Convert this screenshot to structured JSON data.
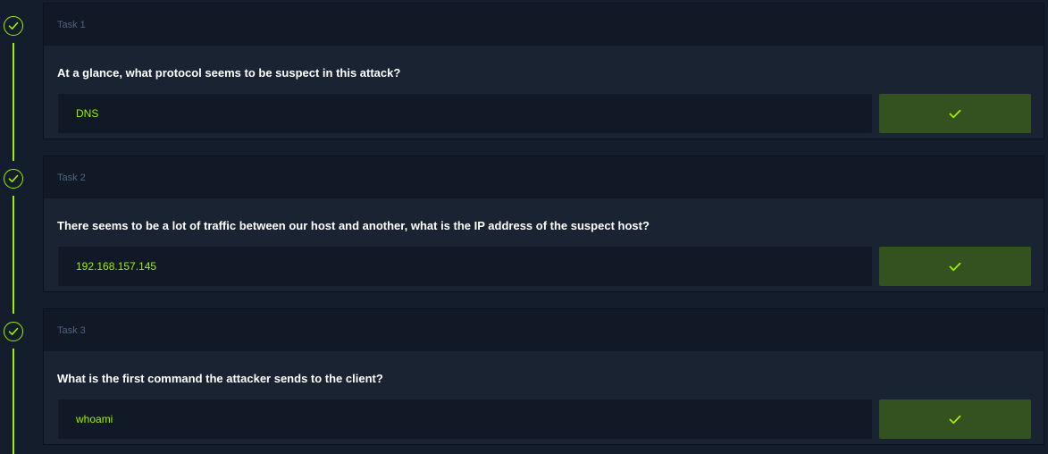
{
  "accent_color": "#9fef00",
  "tasks": [
    {
      "label": "Task 1",
      "question": "At a glance, what protocol seems to be suspect in this attack?",
      "answer": "DNS",
      "status_icon": "check-icon"
    },
    {
      "label": "Task 2",
      "question": "There seems to be a lot of traffic between our host and another, what is the IP address of the suspect host?",
      "answer": "192.168.157.145",
      "status_icon": "check-icon"
    },
    {
      "label": "Task 3",
      "question": "What is the first command the attacker sends to the client?",
      "answer": "whoami",
      "status_icon": "check-icon"
    }
  ]
}
